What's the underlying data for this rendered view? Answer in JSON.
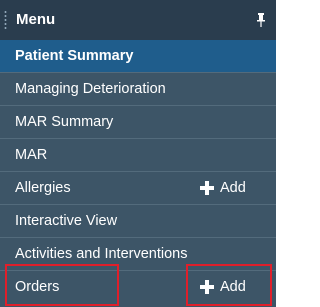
{
  "menu": {
    "title": "Menu",
    "pin_icon": "pin-icon",
    "items": [
      {
        "label": "Patient Summary",
        "selected": true
      },
      {
        "label": "Managing Deterioration"
      },
      {
        "label": "MAR Summary"
      },
      {
        "label": "MAR"
      },
      {
        "label": "Allergies",
        "action": "Add",
        "action_icon": "plus-icon"
      },
      {
        "label": "Interactive View"
      },
      {
        "label": "Activities and Interventions"
      },
      {
        "label": "Orders",
        "action": "Add",
        "action_icon": "plus-icon",
        "highlighted": true
      }
    ]
  },
  "colors": {
    "panel_bg": "#3d5567",
    "header_bg": "#2a3d4e",
    "selected_bg": "#1f5d8c",
    "highlight": "#e01f2a",
    "text": "#ffffff"
  }
}
